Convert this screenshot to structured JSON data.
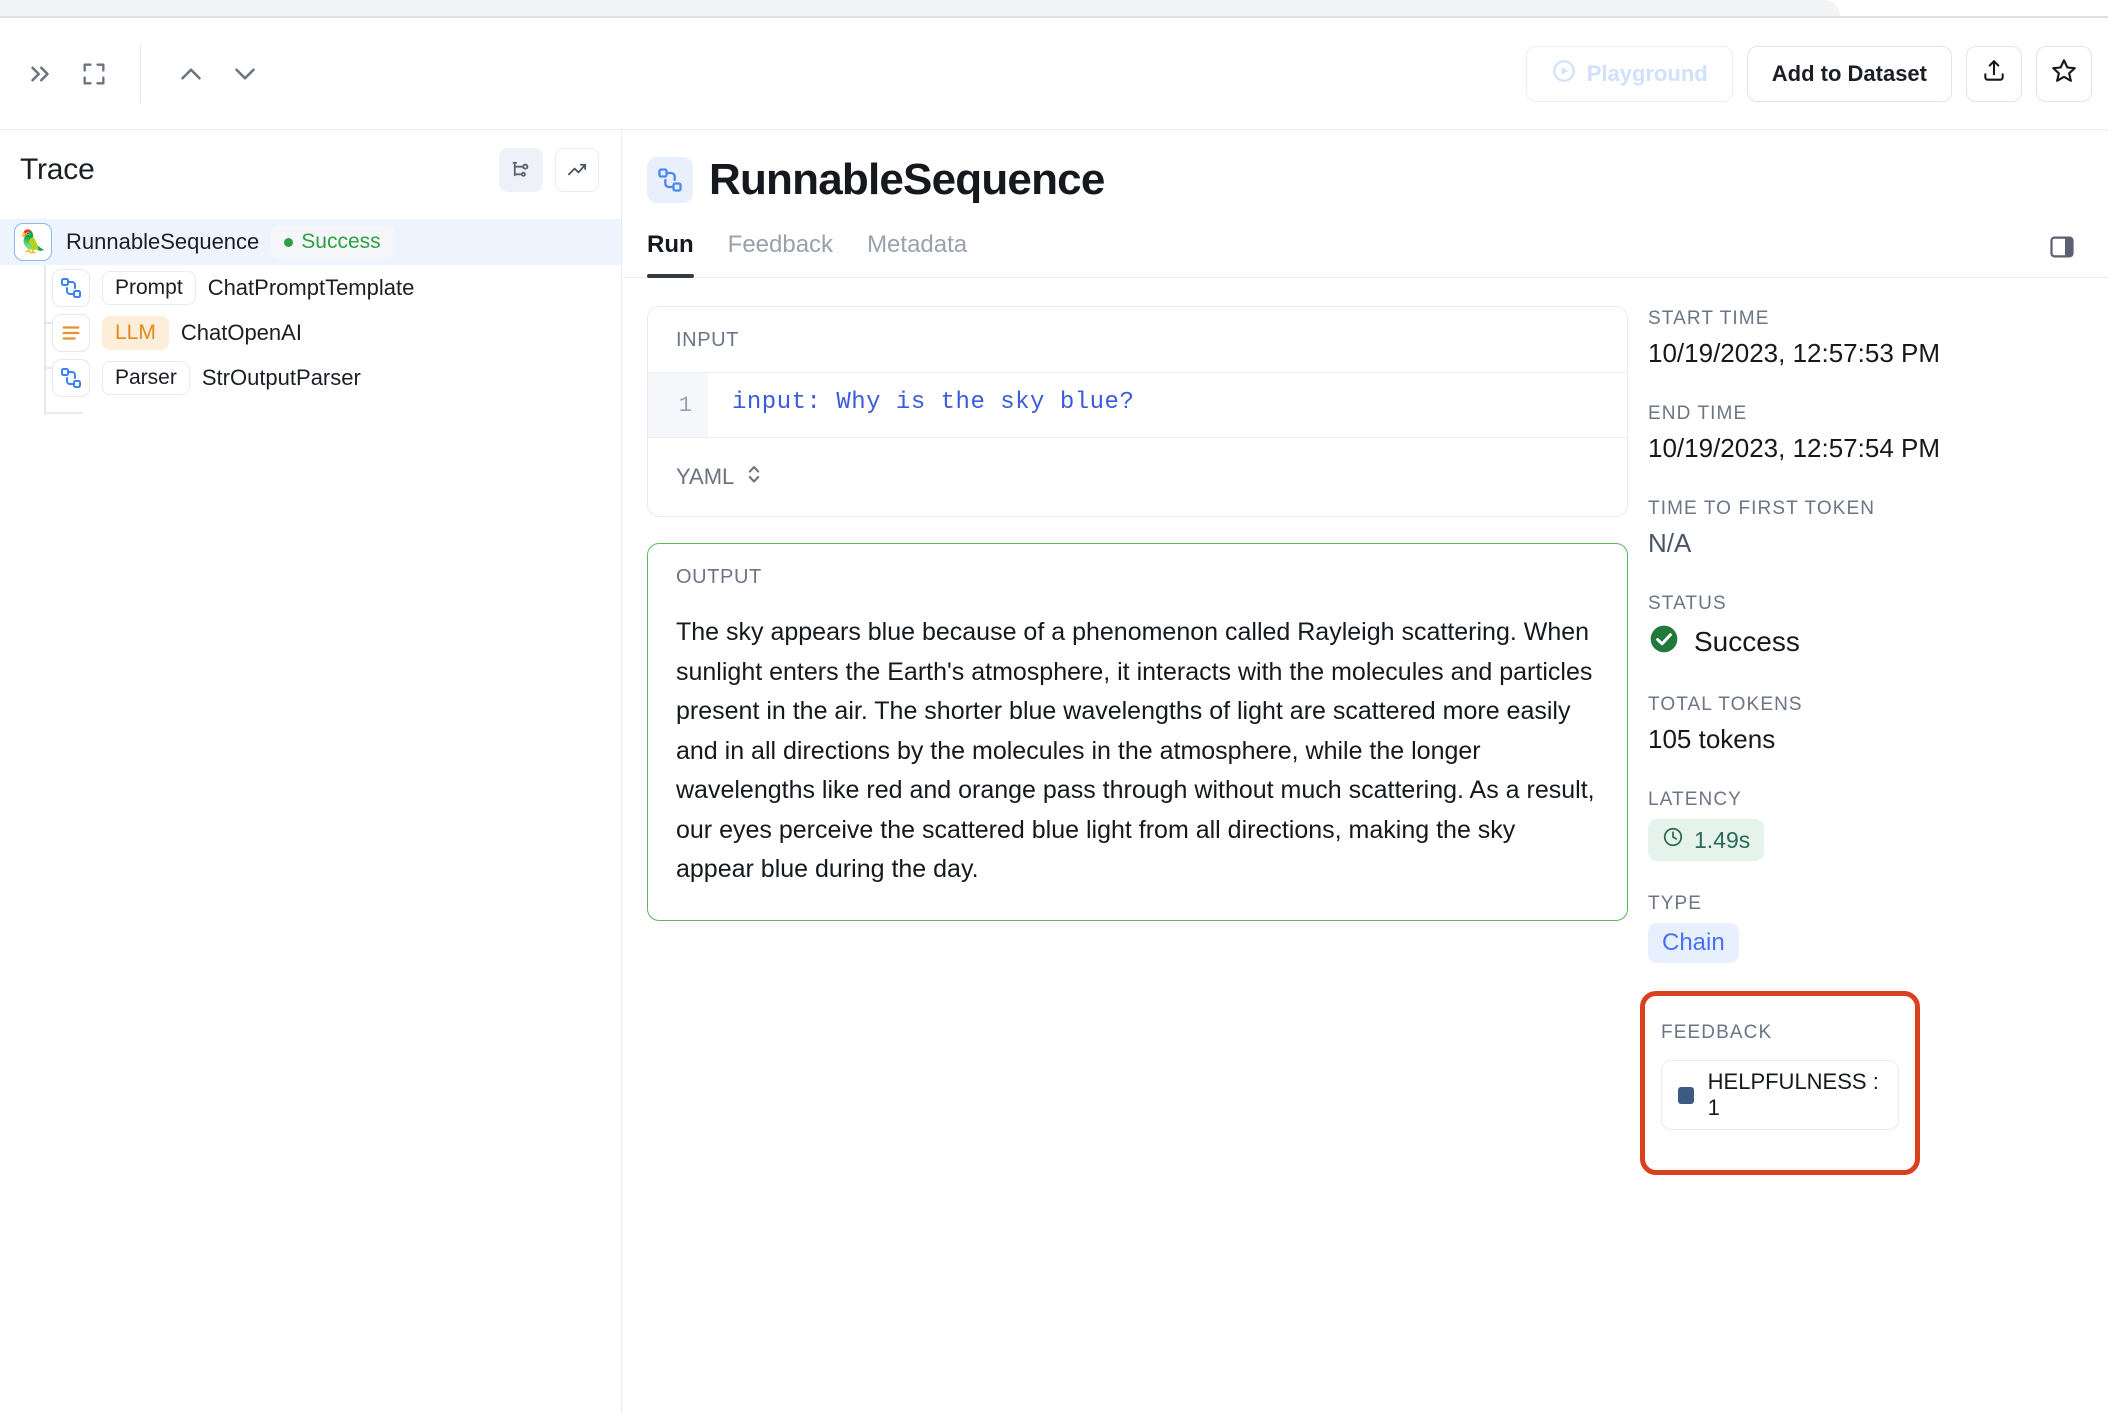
{
  "toolbar": {
    "icons": [
      "chevrons-right-icon",
      "expand-icon",
      "chevron-up-icon",
      "chevron-down-icon"
    ],
    "playground_label": "Playground",
    "add_to_dataset_label": "Add to Dataset",
    "share_icon": "share-upload-icon",
    "star_icon": "star-icon"
  },
  "sidebar": {
    "title": "Trace",
    "actions": [
      "tree-graph-icon",
      "trending-up-icon"
    ],
    "tree": [
      {
        "icon": "parrot-icon",
        "name": "RunnableSequence",
        "status": "Success",
        "selected": true
      },
      {
        "icon": "chain-icon",
        "tag": "Prompt",
        "name": "ChatPromptTemplate"
      },
      {
        "icon": "llm-icon",
        "tag": "LLM",
        "name": "ChatOpenAI"
      },
      {
        "icon": "chain-icon",
        "tag": "Parser",
        "name": "StrOutputParser"
      }
    ]
  },
  "main": {
    "title": "RunnableSequence",
    "title_icon": "chain-icon",
    "tabs": [
      {
        "label": "Run",
        "active": true
      },
      {
        "label": "Feedback",
        "active": false
      },
      {
        "label": "Metadata",
        "active": false
      }
    ],
    "panel_toggle_icon": "side-panel-icon",
    "input": {
      "label": "INPUT",
      "line_number": "1",
      "code": "input: Why is the sky blue?",
      "format": "YAML",
      "format_icon": "chevron-up-down-icon"
    },
    "output": {
      "label": "OUTPUT",
      "text": "The sky appears blue because of a phenomenon called Rayleigh scattering. When sunlight enters the Earth's atmosphere, it interacts with the molecules and particles present in the air. The shorter blue wavelengths of light are scattered more easily and in all directions by the molecules in the atmosphere, while the longer wavelengths like red and orange pass through without much scattering. As a result, our eyes perceive the scattered blue light from all directions, making the sky appear blue during the day."
    }
  },
  "meta": {
    "start_time_label": "START TIME",
    "start_time_value": "10/19/2023, 12:57:53 PM",
    "end_time_label": "END TIME",
    "end_time_value": "10/19/2023, 12:57:54 PM",
    "ttft_label": "TIME TO FIRST TOKEN",
    "ttft_value": "N/A",
    "status_label": "STATUS",
    "status_value": "Success",
    "status_icon": "check-circle-icon",
    "tokens_label": "TOTAL TOKENS",
    "tokens_value": "105 tokens",
    "latency_label": "LATENCY",
    "latency_value": "1.49s",
    "latency_icon": "clock-icon",
    "type_label": "TYPE",
    "type_value": "Chain",
    "feedback_label": "FEEDBACK",
    "feedback_item": "HELPFULNESS : 1"
  },
  "colors": {
    "accent_blue": "#4671f0",
    "success_green": "#2f9e44",
    "output_border": "#5cb85c",
    "highlight_red": "#d9411e",
    "llm_orange": "#e08a1e"
  }
}
